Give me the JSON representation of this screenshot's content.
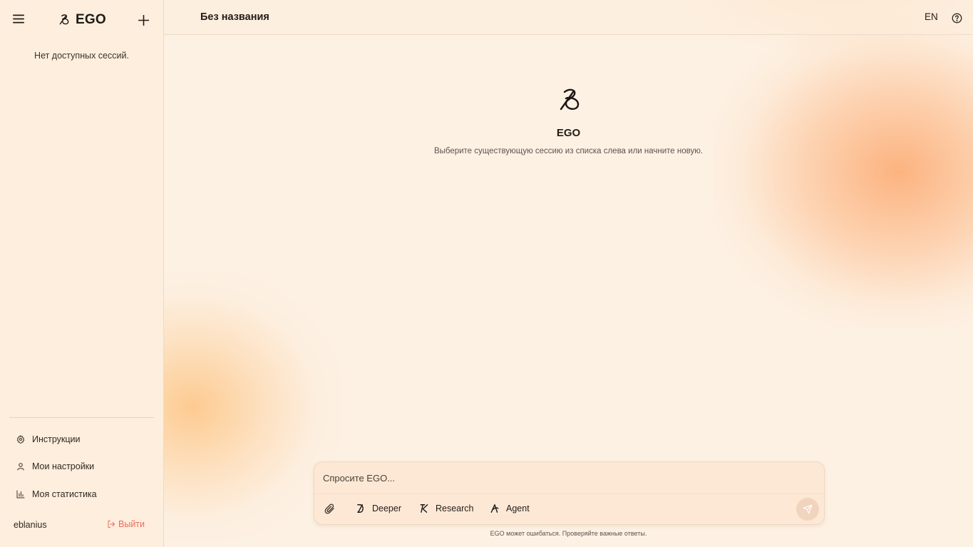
{
  "sidebar": {
    "brand": "EGO",
    "empty_text": "Нет доступных сессий.",
    "items": [
      {
        "label": "Инструкции",
        "icon": "gear-icon"
      },
      {
        "label": "Мои настройки",
        "icon": "user-icon"
      },
      {
        "label": "Моя статистика",
        "icon": "bar-chart-icon"
      }
    ],
    "username": "eblanius",
    "logout_label": "Выйти"
  },
  "header": {
    "title": "Без названия",
    "language": "EN"
  },
  "hero": {
    "title": "EGO",
    "subtitle": "Выберите существующую сессию из списка слева или начните новую."
  },
  "composer": {
    "placeholder": "Спросите EGO...",
    "modes": [
      {
        "label": "Deeper",
        "icon": "deeper-icon"
      },
      {
        "label": "Research",
        "icon": "research-icon"
      },
      {
        "label": "Agent",
        "icon": "agent-icon"
      }
    ]
  },
  "footer": {
    "disclaimer": "EGO может ошибаться. Проверяйте важные ответы."
  },
  "colors": {
    "background": "#fdf1e4",
    "sidebar": "#fdeedd",
    "accent_logout": "#ef6a5e",
    "blob_orange": "#fca86e"
  }
}
